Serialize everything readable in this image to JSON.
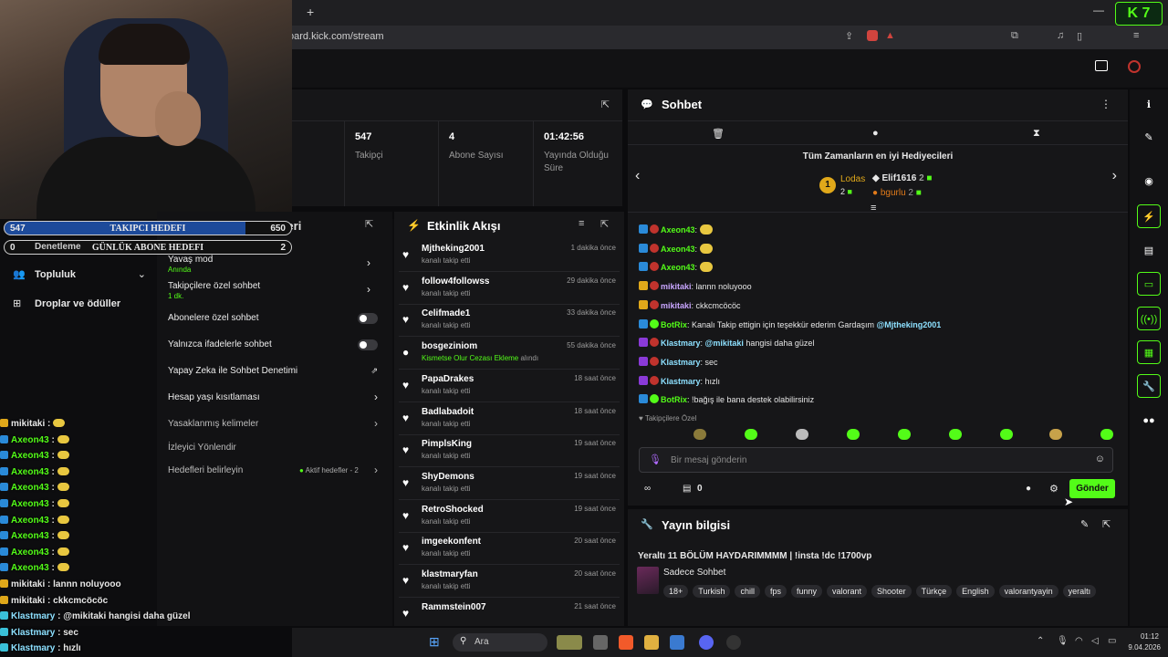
{
  "browser": {
    "new_tab": "+",
    "url": "oard.kick.com/stream",
    "minimize": "—",
    "counter_badge": "K 7"
  },
  "stats": [
    {
      "value": "547",
      "label": "Takipçi"
    },
    {
      "value": "4",
      "label": "Abone Sayısı"
    },
    {
      "value": "01:42:56",
      "label": "Yayında Olduğu Süre"
    }
  ],
  "goals": {
    "follow": {
      "left": "547",
      "title": "TAKIPCI HEDEFI",
      "right": "650",
      "progress": 0.84
    },
    "sub": {
      "left": "0",
      "title": "GÜNLÜK ABONE HEDEFI",
      "right": "2",
      "progress": 0.0
    }
  },
  "left_nav": {
    "moderation": "Denetleme",
    "community": "Topluluk",
    "drops": "Droplar ve ödüller",
    "panel_title_fragment": "emleri"
  },
  "settings": [
    {
      "label": "Yavaş mod",
      "sub": "Anında"
    },
    {
      "label": "Takipçilere özel sohbet",
      "sub": "1 dk."
    },
    {
      "label": "Abonelere özel sohbet"
    },
    {
      "label": "Yalnızca ifadelerle sohbet"
    },
    {
      "label": "Yapay Zeka ile Sohbet Denetimi"
    },
    {
      "label": "Hesap yaşı kısıtlaması"
    },
    {
      "label": "Yasaklanmış kelimeler"
    },
    {
      "label": "İzleyici Yönlendir"
    },
    {
      "label": "Hedefleri belirleyin",
      "sub": "Aktif hedefler - 2"
    }
  ],
  "overlay_chat": [
    {
      "name": "mikitaki",
      "text": ""
    },
    {
      "name": "Axeon43",
      "text": ""
    },
    {
      "name": "Axeon43",
      "text": ""
    },
    {
      "name": "Axeon43",
      "text": ""
    },
    {
      "name": "Axeon43",
      "text": ""
    },
    {
      "name": "Axeon43",
      "text": ""
    },
    {
      "name": "Axeon43",
      "text": ""
    },
    {
      "name": "Axeon43",
      "text": ""
    },
    {
      "name": "Axeon43",
      "text": ""
    },
    {
      "name": "Axeon43",
      "text": ""
    },
    {
      "name": "mikitaki",
      "text": "lannn noluyooo"
    },
    {
      "name": "mikitaki",
      "text": "ckkcmcöcöc"
    },
    {
      "name": "Klastmary",
      "text": "@mikitaki hangisi daha güzel"
    },
    {
      "name": "Klastmary",
      "text": "sec"
    },
    {
      "name": "Klastmary",
      "text": "hızlı"
    }
  ],
  "activity": {
    "title": "Etkinlik Akışı",
    "items": [
      {
        "name": "Mjtheking2001",
        "sub": "kanalı takip etti",
        "time": "1 dakika önce"
      },
      {
        "name": "follow4followss",
        "sub": "kanalı takip etti",
        "time": "29 dakika önce"
      },
      {
        "name": "Celifmade1",
        "sub": "kanalı takip etti",
        "time": "33 dakika önce"
      },
      {
        "name": "bosgeziniom",
        "sub": "Kismetse Olur Cezası Ekleme",
        "sub2": "alındı",
        "time": "55 dakika önce"
      },
      {
        "name": "PapaDrakes",
        "sub": "kanalı takip etti",
        "time": "18 saat önce"
      },
      {
        "name": "Badlabadoit",
        "sub": "kanalı takip etti",
        "time": "18 saat önce"
      },
      {
        "name": "PimplsKing",
        "sub": "kanalı takip etti",
        "time": "19 saat önce"
      },
      {
        "name": "ShyDemons",
        "sub": "kanalı takip etti",
        "time": "19 saat önce"
      },
      {
        "name": "RetroShocked",
        "sub": "kanalı takip etti",
        "time": "19 saat önce"
      },
      {
        "name": "imgeekonfent",
        "sub": "kanalı takip etti",
        "time": "20 saat önce"
      },
      {
        "name": "klastmaryfan",
        "sub": "kanalı takip etti",
        "time": "20 saat önce"
      },
      {
        "name": "Rammstein007",
        "sub": "",
        "time": "21 saat önce"
      }
    ]
  },
  "chat": {
    "title": "Sohbet",
    "top_gifters_title": "Tüm Zamanların en iyi Hediyecileri",
    "gifters": [
      {
        "rank": "1",
        "name": "Lodas",
        "count": "2"
      },
      {
        "name": "Elif1616",
        "count": "2"
      },
      {
        "name": "bgurlu",
        "count": "2"
      }
    ],
    "messages": [
      {
        "name": "Axeon43",
        "text": "",
        "color": "#53fc18"
      },
      {
        "name": "Axeon43",
        "text": "",
        "color": "#53fc18"
      },
      {
        "name": "Axeon43",
        "text": "",
        "color": "#53fc18"
      },
      {
        "name": "mikitaki",
        "text": "lannn noluyooo",
        "color": "#c9a6ff"
      },
      {
        "name": "mikitaki",
        "text": "ckkcmcöcöc",
        "color": "#c9a6ff"
      },
      {
        "name": "BotRix",
        "text": "Kanalı Takip ettigin için teşekkür ederim Gardaşım",
        "mention": "@Mjtheking2001",
        "color": "#53fc18"
      },
      {
        "name": "Klastmary",
        "mention_first": "@mikitaki",
        "text": "hangisi daha güzel",
        "color": "#8de0ff"
      },
      {
        "name": "Klastmary",
        "text": "sec",
        "color": "#8de0ff"
      },
      {
        "name": "Klastmary",
        "text": "hızlı",
        "color": "#8de0ff"
      },
      {
        "name": "BotRix",
        "text": "!bağış ile bana destek olabilirsiniz",
        "color": "#53fc18"
      }
    ],
    "followers_only": "Takipçilere Özel",
    "placeholder": "Bir mesaj gönderin",
    "count": "0",
    "send": "Gönder"
  },
  "stream_info": {
    "title": "Yayın bilgisi",
    "stream_title": "Yeraltı 11 BÖLÜM HAYDARIMMMM | !insta !dc !1700vp",
    "category": "Sadece Sohbet",
    "tags": [
      "18+",
      "Turkish",
      "chill",
      "fps",
      "funny",
      "valorant",
      "Shooter",
      "Türkçe",
      "English",
      "valorantyayin",
      "yeraltı"
    ]
  },
  "taskbar": {
    "search": "Ara",
    "time": "01:12",
    "date": "9.04.2026"
  },
  "colors": {
    "accent": "#53fc18",
    "bg": "#0b0b0d",
    "panel": "#161618"
  }
}
